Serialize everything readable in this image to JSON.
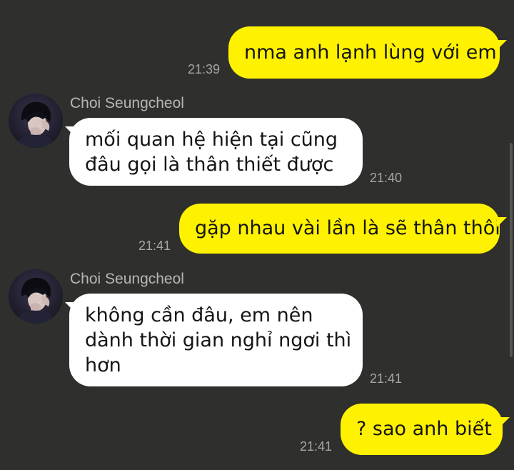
{
  "contact": {
    "name": "Choi Seungcheol",
    "avatar_icon": "profile-photo-icon"
  },
  "colors": {
    "background": "#2f302d",
    "outgoing_bubble": "#fff200",
    "incoming_bubble": "#ffffff",
    "timestamp": "#a7a7a2"
  },
  "messages": [
    {
      "direction": "outgoing",
      "text": "nma anh lạnh lùng với em",
      "time": "21:39"
    },
    {
      "direction": "incoming",
      "sender": "Choi Seungcheol",
      "lines": [
        "mối quan hệ hiện tại cũng",
        "đâu gọi là thân thiết được"
      ],
      "time": "21:40"
    },
    {
      "direction": "outgoing",
      "text": "gặp nhau vài lần là sẽ thân thôi",
      "time": "21:41"
    },
    {
      "direction": "incoming",
      "sender": "Choi Seungcheol",
      "lines": [
        "không cần đâu, em nên",
        "dành thời gian nghỉ ngơi thì",
        "hơn"
      ],
      "time": "21:41"
    },
    {
      "direction": "outgoing",
      "text": "? sao anh biết",
      "time": "21:41"
    }
  ]
}
